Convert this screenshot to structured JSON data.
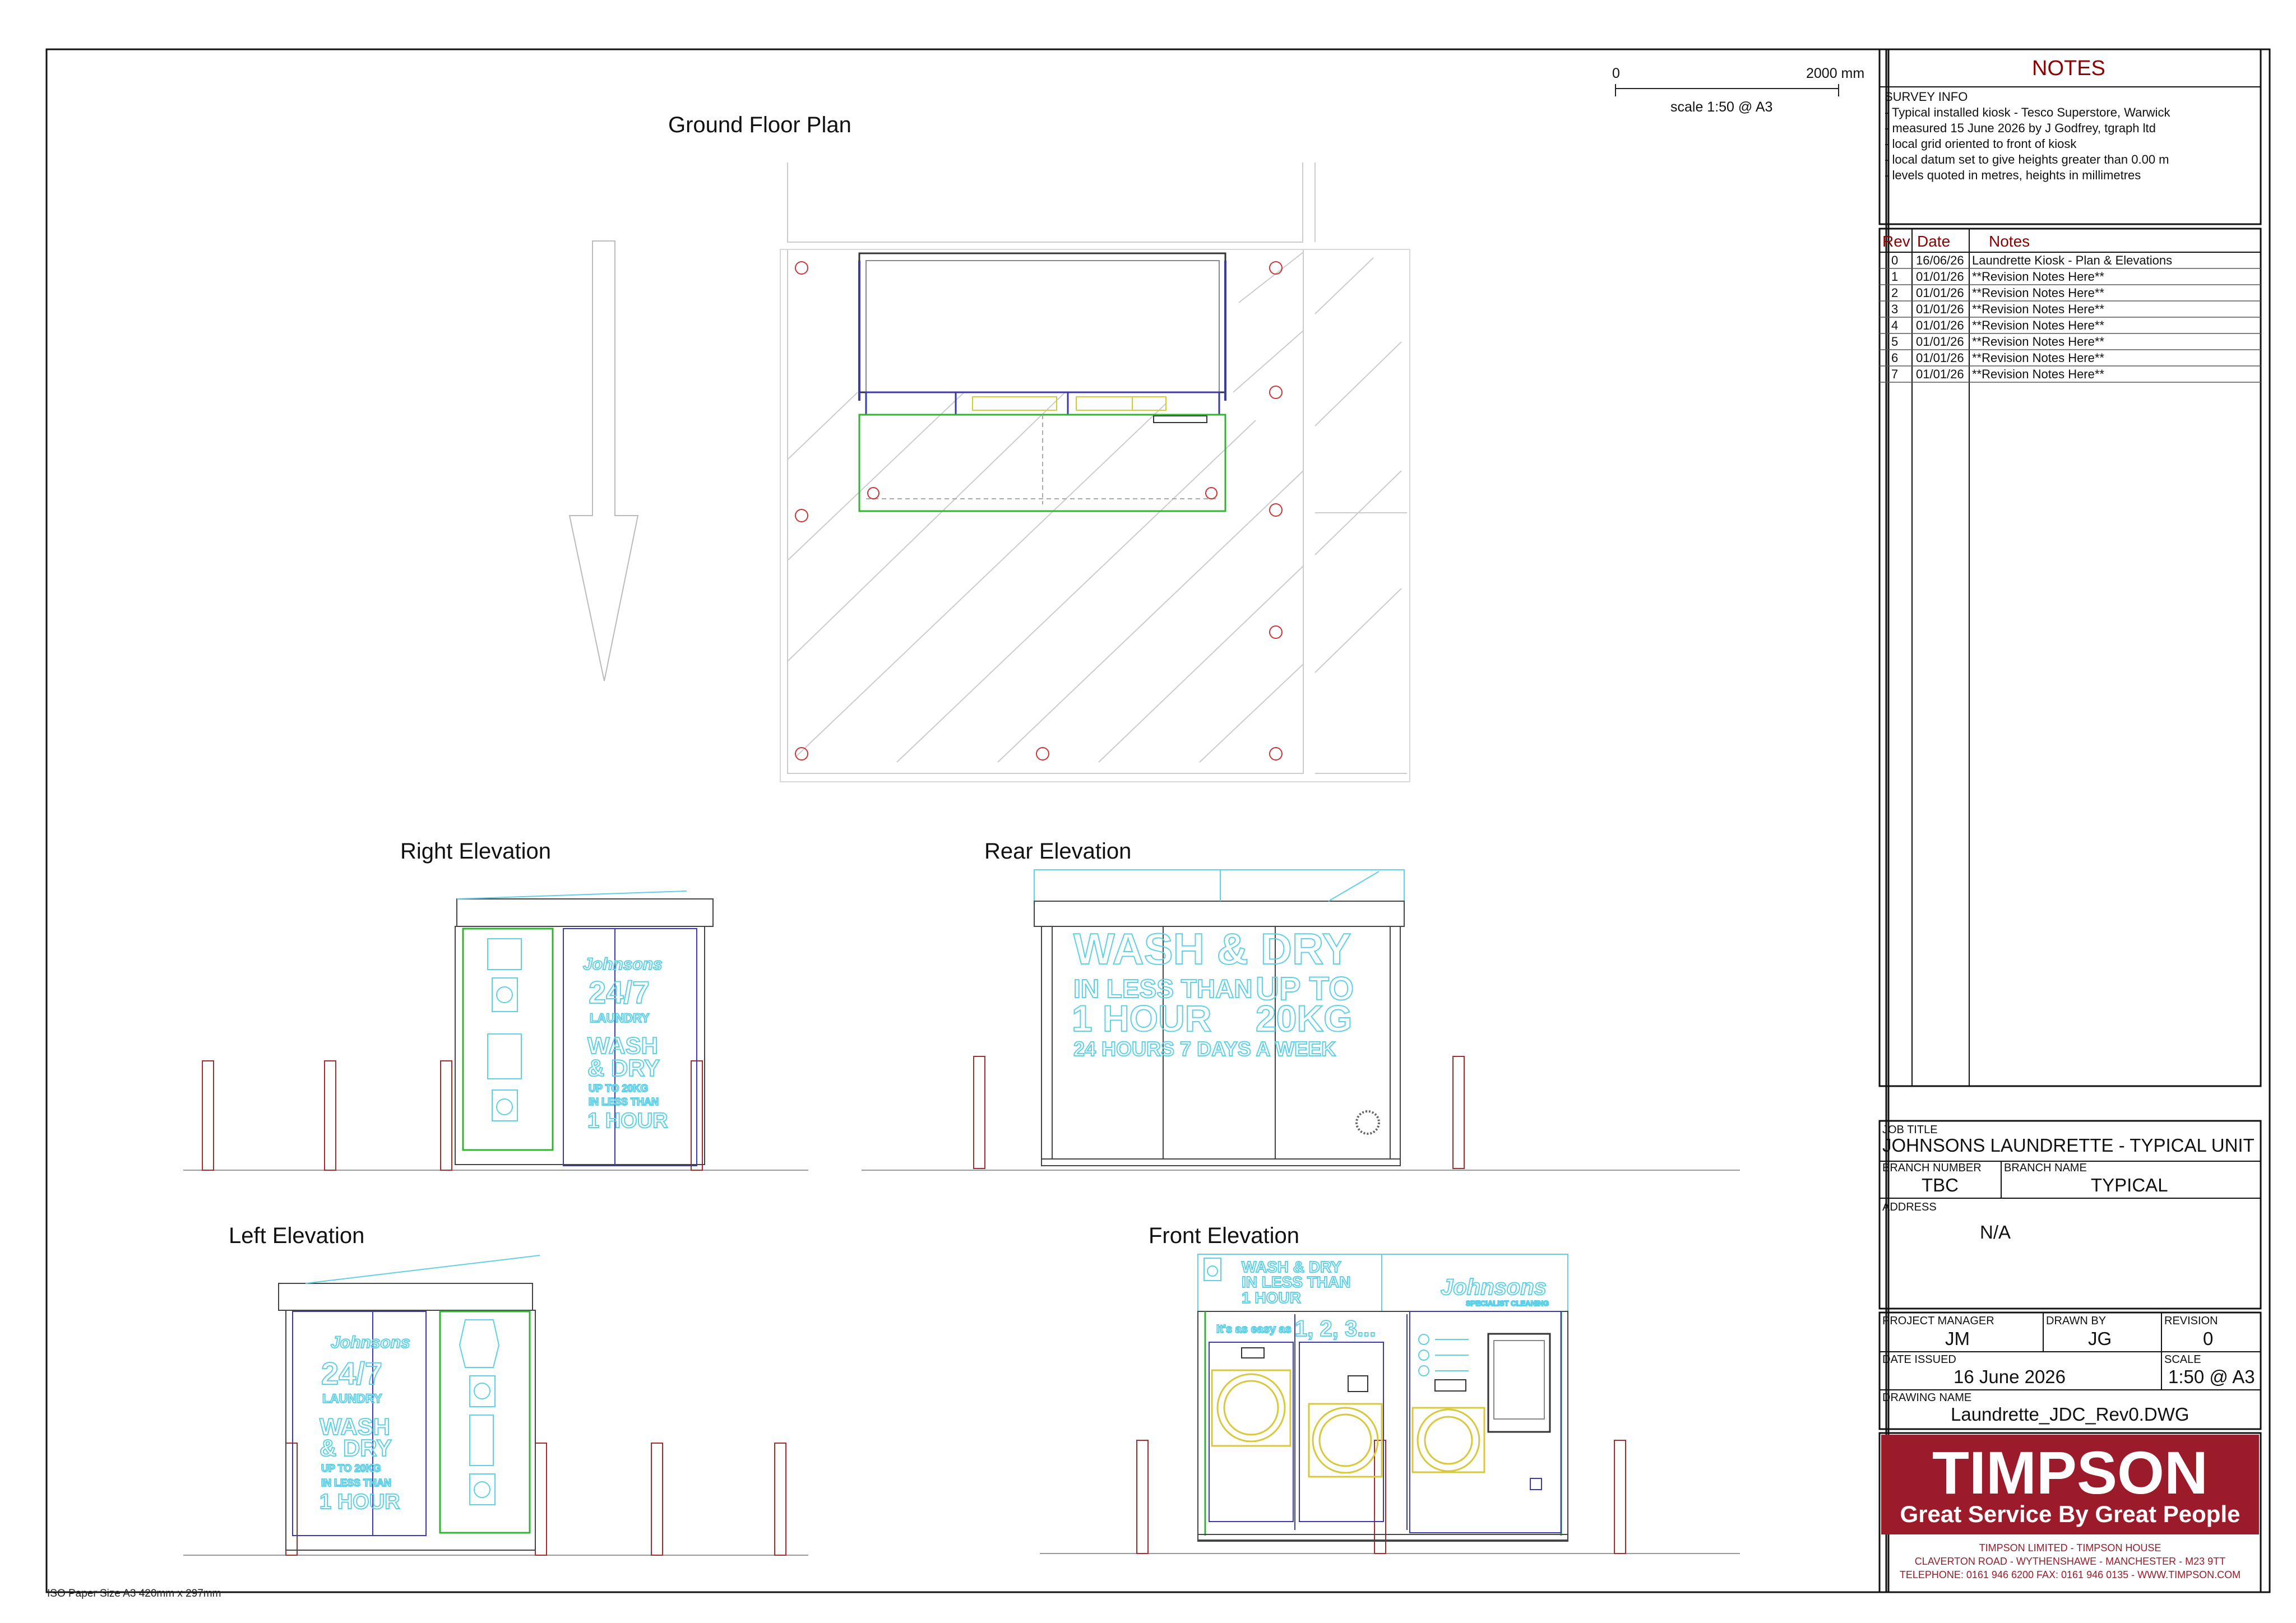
{
  "scale_bar": {
    "start": "0",
    "end": "2000 mm",
    "scale": "scale 1:50 @ A3"
  },
  "views": {
    "plan": "Ground Floor Plan",
    "right": "Right Elevation",
    "rear": "Rear Elevation",
    "left": "Left Elevation",
    "front": "Front Elevation"
  },
  "graphics": {
    "rear_line1": "WASH & DRY",
    "rear_line2a": "IN LESS THAN",
    "rear_line2b": "UP TO",
    "rear_line3a": "1 HOUR",
    "rear_line3b": "20KG",
    "rear_line4": "24 HOURS 7 DAYS A WEEK",
    "side_247": "24/7",
    "side_laundry": "LAUNDRY",
    "side_wash": "WASH",
    "side_dry": "& DRY",
    "side_upto": "UP TO 20KG",
    "side_inless": "IN LESS THAN",
    "side_hour": "1 HOUR",
    "brand_script": "Johnsons",
    "brand_sub": "SPECIALIST CLEANING",
    "front_head1": "WASH & DRY",
    "front_head2": "IN LESS THAN",
    "front_head3": "1 HOUR",
    "front_easy": "It's as easy as",
    "front_steps": "1, 2, 3..."
  },
  "notes": {
    "title": "NOTES",
    "heading": "SURVEY INFO",
    "lines": [
      "- Typical installed kiosk - Tesco Superstore, Warwick",
      "- measured 15 June 2026 by J Godfrey, tgraph ltd",
      "- local grid oriented to front of kiosk",
      "- local datum set to give heights greater than 0.00 m",
      "- levels quoted in metres, heights in millimetres"
    ]
  },
  "revisions": {
    "headers": {
      "rev": "Rev",
      "date": "Date",
      "notes": "Notes"
    },
    "rows": [
      {
        "rev": "0",
        "date": "16/06/26",
        "note": "Laundrette Kiosk - Plan & Elevations"
      },
      {
        "rev": "1",
        "date": "01/01/26",
        "note": "**Revision Notes Here**"
      },
      {
        "rev": "2",
        "date": "01/01/26",
        "note": "**Revision Notes Here**"
      },
      {
        "rev": "3",
        "date": "01/01/26",
        "note": "**Revision Notes Here**"
      },
      {
        "rev": "4",
        "date": "01/01/26",
        "note": "**Revision Notes Here**"
      },
      {
        "rev": "5",
        "date": "01/01/26",
        "note": "**Revision Notes Here**"
      },
      {
        "rev": "6",
        "date": "01/01/26",
        "note": "**Revision Notes Here**"
      },
      {
        "rev": "7",
        "date": "01/01/26",
        "note": "**Revision Notes Here**"
      }
    ]
  },
  "title_block": {
    "job_title_label": "JOB TITLE",
    "job_title": "JOHNSONS LAUNDRETTE - TYPICAL UNIT",
    "branch_number_label": "BRANCH NUMBER",
    "branch_number": "TBC",
    "branch_name_label": "BRANCH NAME",
    "branch_name": "TYPICAL",
    "address_label": "ADDRESS",
    "address": "N/A",
    "pm_label": "PROJECT MANAGER",
    "pm": "JM",
    "drawn_label": "DRAWN BY",
    "drawn": "JG",
    "revision_label": "REVISION",
    "revision": "0",
    "date_label": "DATE ISSUED",
    "date": "16 June 2026",
    "scale_label": "SCALE",
    "scale": "1:50 @ A3",
    "drawing_label": "DRAWING NAME",
    "drawing": "Laundrette_JDC_Rev0.DWG"
  },
  "company": {
    "logo": "TIMPSON",
    "tagline": "Great Service By Great People",
    "line1": "TIMPSON LIMITED - TIMPSON HOUSE",
    "line2": "CLAVERTON ROAD - WYTHENSHAWE - MANCHESTER - M23 9TT",
    "line3": "TELEPHONE: 0161 946 6200  FAX: 0161 946 0135 - WWW.TIMPSON.COM",
    "brand_color": "#9b1b2a"
  },
  "footer": {
    "paper": "ISO Paper Size A3 420mm x 297mm"
  }
}
